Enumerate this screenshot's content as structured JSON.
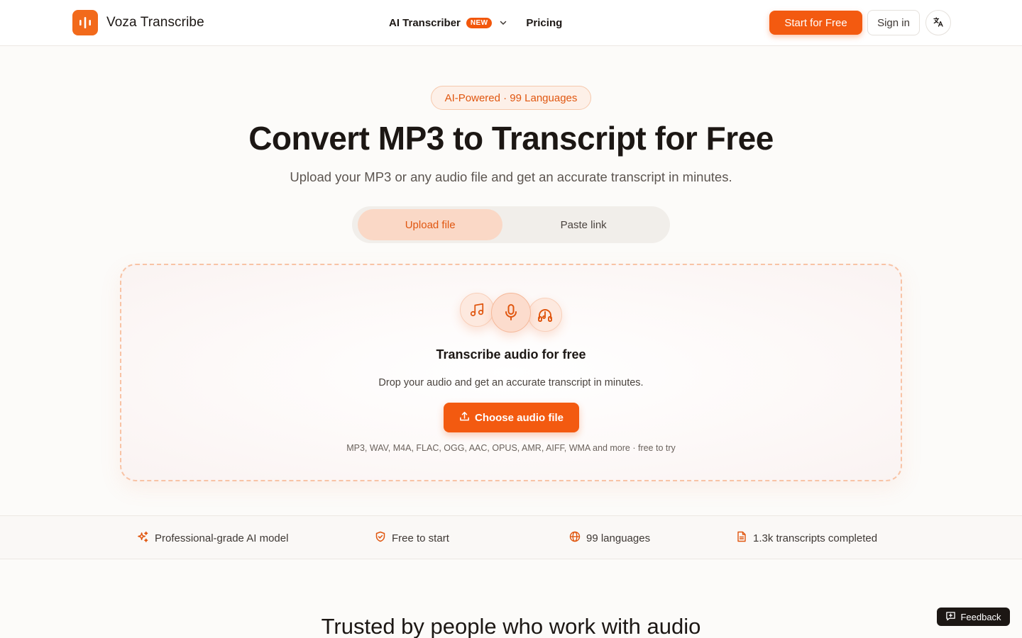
{
  "header": {
    "brand": "Voza Transcribe",
    "nav": {
      "ai_transcriber": "AI Transcriber",
      "new_badge": "NEW",
      "pricing": "Pricing"
    },
    "start_button": "Start for Free",
    "signin_button": "Sign in",
    "language_icon": "translate-icon"
  },
  "hero": {
    "badge": "AI-Powered · 99 Languages",
    "title": "Convert MP3 to Transcript for Free",
    "subtitle": "Upload your MP3 or any audio file and get an accurate transcript in minutes."
  },
  "tabs": {
    "upload": "Upload file",
    "paste": "Paste link",
    "active": "upload"
  },
  "dropzone": {
    "icons": [
      "music-note-icon",
      "microphone-icon",
      "headphones-icon"
    ],
    "title": "Transcribe audio for free",
    "subtitle": "Drop your audio and get an accurate transcript in minutes.",
    "button": "Choose audio file",
    "formats": "MP3, WAV, M4A, FLAC, OGG, AAC, OPUS, AMR, AIFF, WMA and more · free to try"
  },
  "features": [
    {
      "icon": "sparkles-icon",
      "label": "Professional-grade AI model"
    },
    {
      "icon": "shield-check-icon",
      "label": "Free to start"
    },
    {
      "icon": "globe-icon",
      "label": "99 languages"
    },
    {
      "icon": "document-icon",
      "label": "1.3k transcripts completed"
    }
  ],
  "trusted_heading": "Trusted by people who work with audio",
  "feedback_button": "Feedback",
  "colors": {
    "accent": "#f35a10",
    "accent_soft": "#fad8c6",
    "text": "#1c1714",
    "muted": "#5c5550"
  }
}
